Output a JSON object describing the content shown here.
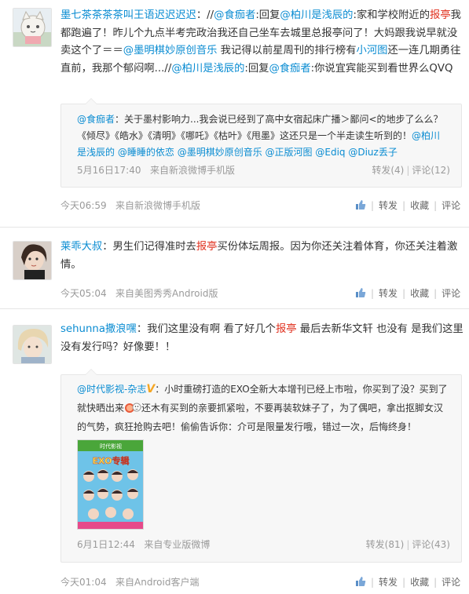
{
  "post1": {
    "author": "墨七茶茶茶茶叫王语迟迟迟迟",
    "colon": "：",
    "text_a": "//",
    "mention_a": "@食痂者",
    "text_b": ":回复",
    "mention_b": "@柏川是浅辰的",
    "text_c": ":家和学校附近的",
    "hl_a": "报亭",
    "text_d": "我都跑遍了！昨儿个九点半考完政治我还自己坐车去城里总报亭问了！大妈跟我说早就没卖这个了＝＝",
    "mention_c": "@墨明棋妙原创音乐",
    "text_e": " 我记得以前星周刊的排行榜有",
    "mention_d": "小河图",
    "text_f": "还一连几期勇往直前，我那个郁闷啊...//",
    "mention_e": "@柏川是浅辰的",
    "text_g": ":回复",
    "mention_f": "@食痂者",
    "text_h": ":你说宜宾能买到看世界么QVQ",
    "quote": {
      "author": "@食痂者",
      "text_a": "：关于墨村影响力...我会说已经到了高中女宿起床广播＞鄙问<的地步了么么？《倾尽》《皓水》《清明》《哪吒》《枯叶》《甩墨》这还只是一个半走读生听到的！",
      "mention_a": "@柏川是浅辰的",
      "mention_b": "@睡睡的依恋",
      "mention_c": "@墨明棋妙原创音乐",
      "mention_d": "@正版河图",
      "mention_e": "@Ediq",
      "mention_f": "@Diuz丢子",
      "time": "5月16日17:40",
      "source": "来自新浪微博手机版",
      "repost": "转发(4)",
      "comment": "评论(12)"
    },
    "time": "今天06:59",
    "source": "来自新浪微博手机版"
  },
  "post2": {
    "author": "莱乖大叔",
    "colon": "：",
    "text_a": "男生们记得准时去",
    "hl_a": "报亭",
    "text_b": "买份体坛周报。因为你还关注着体育，你还关注着激情。",
    "time": "今天05:04",
    "source": "来自美图秀秀Android版"
  },
  "post3": {
    "author": "sehunna撒浪嘿",
    "colon": "：",
    "text_a": "我们这里没有啊 看了好几个",
    "hl_a": "报亭",
    "text_b": " 最后去新华文轩 也没有 是我们这里没有发行吗？好像要！！",
    "quote": {
      "author": "@时代影视-杂志",
      "v": "V",
      "text_a": "：小时重磅打造的EXO全新大本增刊已经上市啦，你买到了没？买到了就快晒出来",
      "text_b": "还木有买到的亲要抓紧啦，不要再装软妹子了，为了偶吧，拿出抠脚女汉的气势，疯狂抢购去吧！偷偷告诉你：介可是限量发行哦，错过一次，后悔终身！",
      "cover_title": "EXO专辑",
      "cover_top": "时代影视",
      "time": "6月1日12:44",
      "source": "来自专业版微博",
      "repost": "转发(81)",
      "comment": "评论(43)"
    },
    "time": "今天01:04",
    "source": "来自Android客户端"
  },
  "actions": {
    "repost": "转发",
    "favorite": "收藏",
    "comment": "评论",
    "from_prefix": "",
    "pipe": "|"
  },
  "colors": {
    "link": "#0a8cd2",
    "highlight": "#e0301e",
    "meta": "#9a9a9a"
  }
}
